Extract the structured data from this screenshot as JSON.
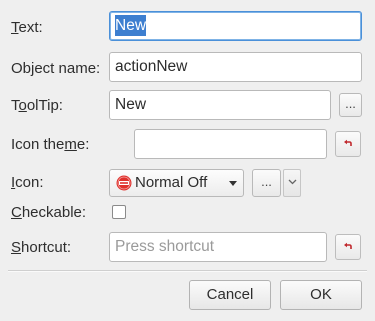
{
  "form": {
    "text": {
      "label_prefix": "",
      "label_mnemonic": "T",
      "label_suffix": "ext:",
      "value": "New"
    },
    "object_name": {
      "label": "Object name:",
      "value": "actionNew"
    },
    "tooltip": {
      "label_prefix": "T",
      "label_mnemonic": "o",
      "label_suffix": "olTip:",
      "value": "New",
      "browse_label": "..."
    },
    "icon_theme": {
      "label_prefix": "Icon the",
      "label_mnemonic": "m",
      "label_suffix": "e:",
      "value": ""
    },
    "icon": {
      "label_prefix": "",
      "label_mnemonic": "I",
      "label_suffix": "con:",
      "mode_value": "Normal Off",
      "browse_label": "...",
      "preview_icon": "new-document-icon"
    },
    "checkable": {
      "label_prefix": "",
      "label_mnemonic": "C",
      "label_suffix": "heckable:",
      "checked": false
    },
    "shortcut": {
      "label_prefix": "",
      "label_mnemonic": "S",
      "label_suffix": "hortcut:",
      "placeholder": "Press shortcut"
    }
  },
  "buttons": {
    "cancel": "Cancel",
    "ok": "OK"
  },
  "colors": {
    "accent": "#3d7fd0",
    "reset_arrow": "#c0282d",
    "icon_red": "#e0302c"
  }
}
